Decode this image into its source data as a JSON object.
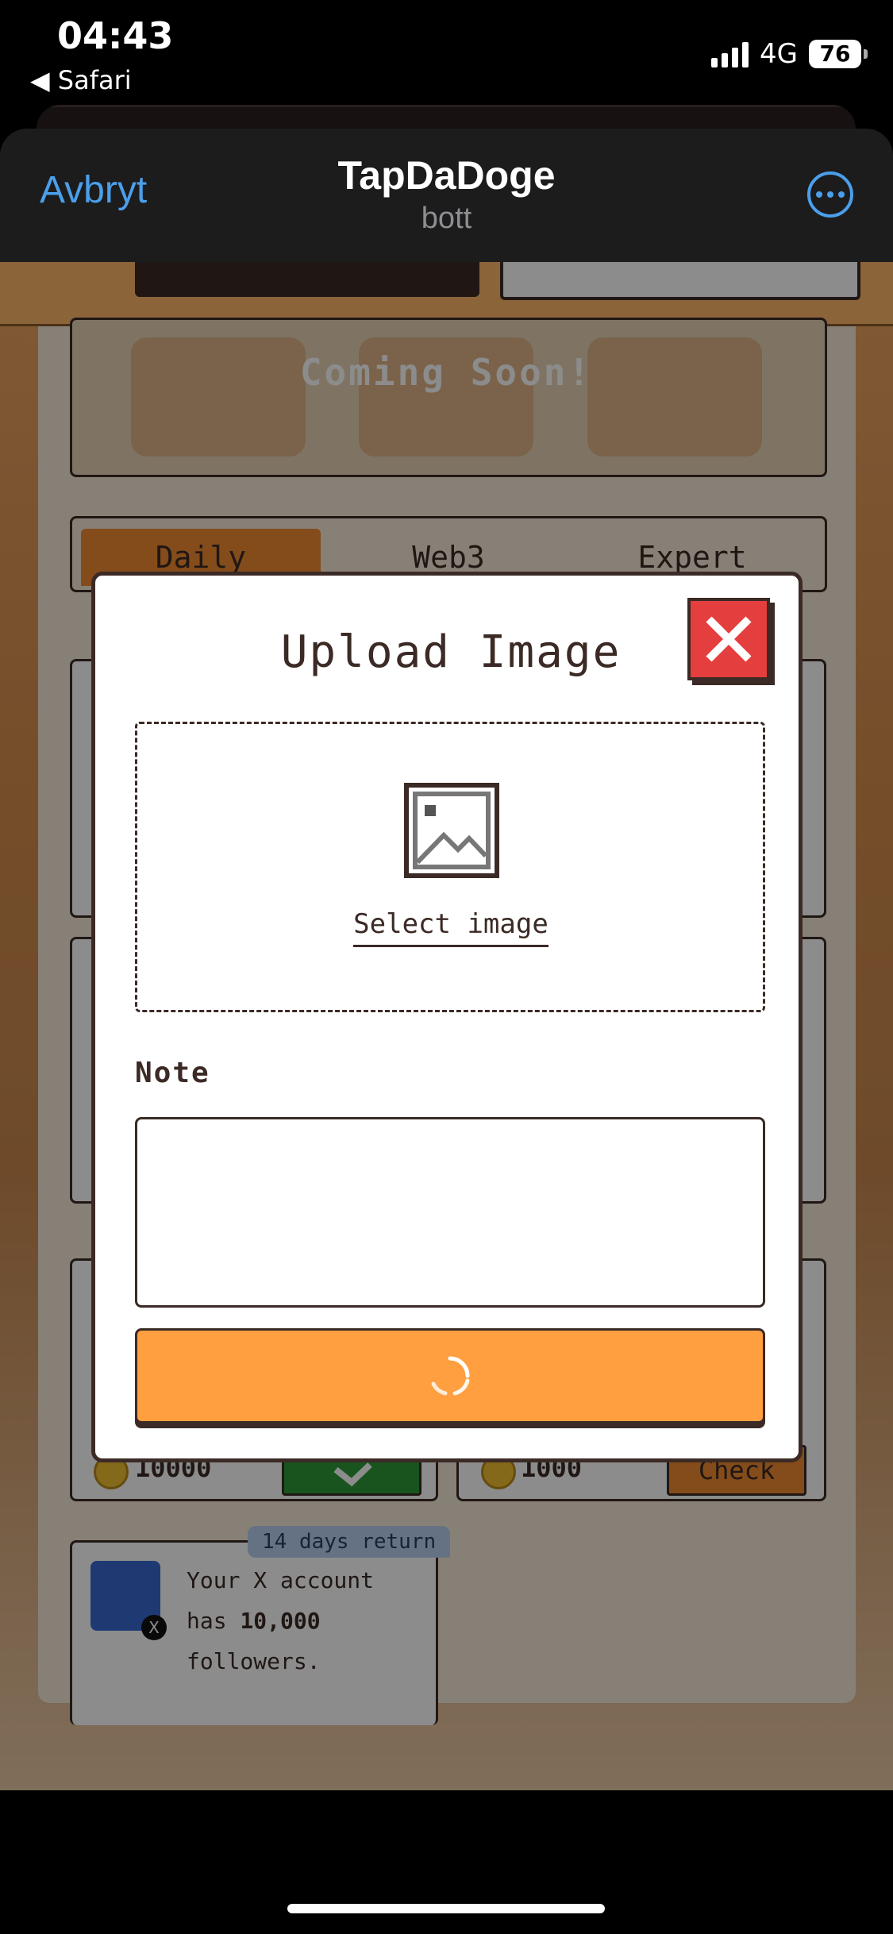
{
  "status_bar": {
    "time": "04:43",
    "back_app": "◀ Safari",
    "network": "4G",
    "battery": "76"
  },
  "telegram_header": {
    "cancel": "Avbryt",
    "title": "TapDaDoge",
    "subtitle": "bott",
    "more_icon": "more-dots-icon"
  },
  "background": {
    "banner": "Coming Soon!",
    "tabs": [
      "Daily",
      "Web3",
      "Expert"
    ],
    "tasks": [
      {
        "reward": "10000",
        "action": "check-icon"
      },
      {
        "reward": "1000",
        "action": "Check"
      }
    ],
    "task_card": {
      "badge": "14 days return",
      "text_1": "Your X account",
      "text_2_prefix": "has ",
      "text_2_bold": "10,000",
      "text_3": "followers."
    }
  },
  "modal": {
    "title": "Upload Image",
    "close_icon": "close-x-icon",
    "upload": {
      "icon": "image-placeholder-icon",
      "label": "Select image"
    },
    "note_label": "Note",
    "note_value": "",
    "submit": {
      "state": "loading",
      "icon": "spinner-icon"
    }
  },
  "colors": {
    "accent": "#ff9f40",
    "close_red": "#e53e3e",
    "ink": "#3b2a25",
    "telegram_blue": "#4b9fea"
  }
}
